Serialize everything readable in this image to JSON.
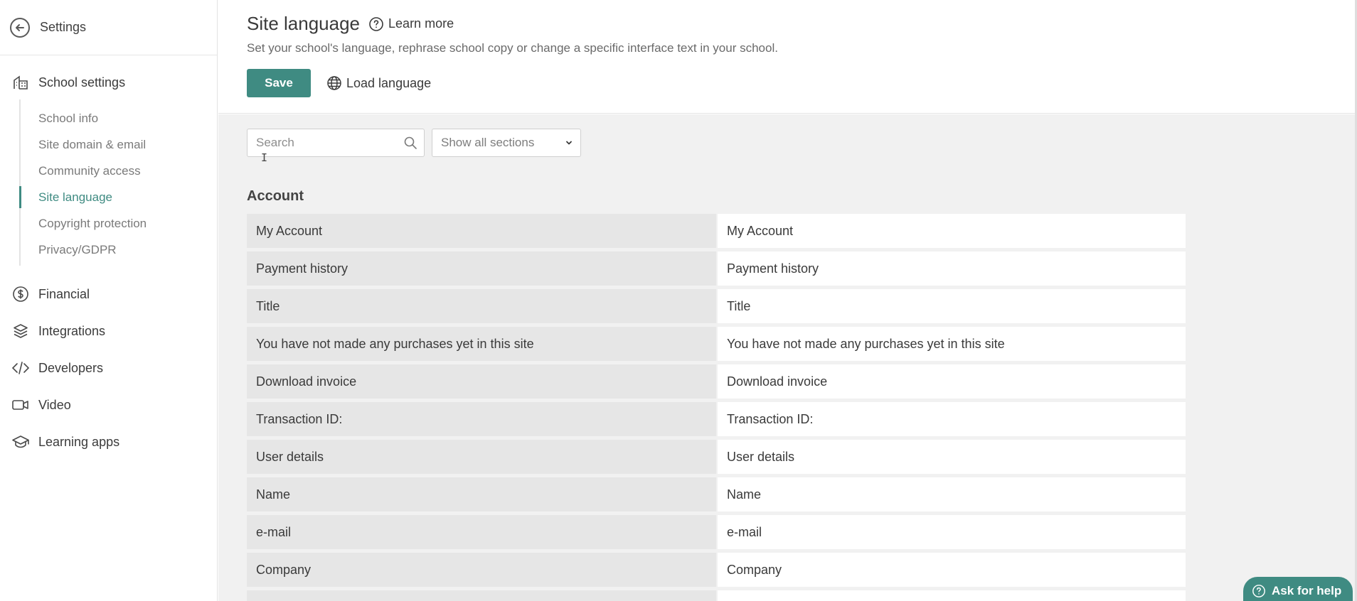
{
  "sidebar": {
    "back_label": "Settings",
    "section_label": "School settings",
    "sub_items": [
      {
        "label": "School info",
        "active": false
      },
      {
        "label": "Site domain & email",
        "active": false
      },
      {
        "label": "Community access",
        "active": false
      },
      {
        "label": "Site language",
        "active": true
      },
      {
        "label": "Copyright protection",
        "active": false
      },
      {
        "label": "Privacy/GDPR",
        "active": false
      }
    ],
    "nav_items": [
      {
        "label": "Financial",
        "icon": "dollar-circle-icon"
      },
      {
        "label": "Integrations",
        "icon": "layers-icon"
      },
      {
        "label": "Developers",
        "icon": "code-icon"
      },
      {
        "label": "Video",
        "icon": "video-camera-icon"
      },
      {
        "label": "Learning apps",
        "icon": "graduation-cap-icon"
      }
    ]
  },
  "header": {
    "title": "Site language",
    "learn_more": "Learn more",
    "subtitle": "Set your school's language, rephrase school copy or change a specific interface text in your school.",
    "save_label": "Save",
    "load_language_label": "Load language"
  },
  "filters": {
    "search_placeholder": "Search",
    "section_select": "Show all sections"
  },
  "group": {
    "title": "Account",
    "rows": [
      {
        "key": "My Account",
        "value": "My Account"
      },
      {
        "key": "Payment history",
        "value": "Payment history"
      },
      {
        "key": "Title",
        "value": "Title"
      },
      {
        "key": "You have not made any purchases yet in this site",
        "value": "You have not made any purchases yet in this site"
      },
      {
        "key": "Download invoice",
        "value": "Download invoice"
      },
      {
        "key": "Transaction ID:",
        "value": "Transaction ID:"
      },
      {
        "key": "User details",
        "value": "User details"
      },
      {
        "key": "Name",
        "value": "Name"
      },
      {
        "key": "e-mail",
        "value": "e-mail"
      },
      {
        "key": "Company",
        "value": "Company"
      },
      {
        "key": "",
        "value": ""
      }
    ]
  },
  "help": {
    "label": "Ask for help"
  },
  "colors": {
    "accent": "#3f8b82",
    "panel_bg": "#f1f1f1",
    "key_bg": "#e6e6e6"
  }
}
